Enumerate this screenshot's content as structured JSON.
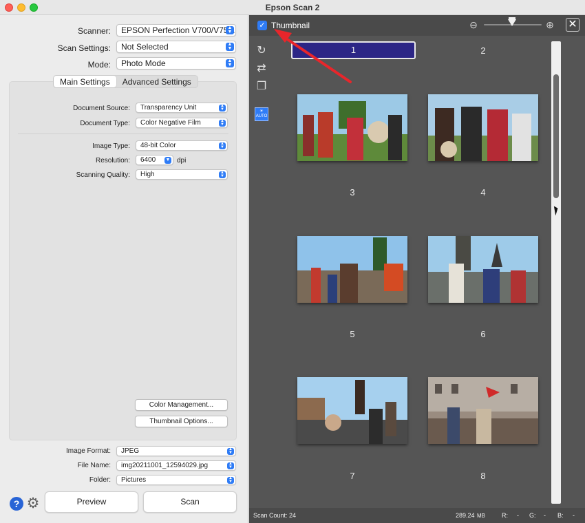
{
  "window": {
    "title": "Epson Scan 2"
  },
  "scanner": {
    "label": "Scanner:",
    "value": "EPSON Perfection V700/V75..."
  },
  "scan_settings": {
    "label": "Scan Settings:",
    "value": "Not Selected"
  },
  "mode": {
    "label": "Mode:",
    "value": "Photo Mode"
  },
  "tabs": {
    "main": "Main Settings",
    "advanced": "Advanced Settings"
  },
  "document_source": {
    "label": "Document Source:",
    "value": "Transparency Unit"
  },
  "document_type": {
    "label": "Document Type:",
    "value": "Color Negative Film"
  },
  "image_type": {
    "label": "Image Type:",
    "value": "48-bit Color"
  },
  "resolution": {
    "label": "Resolution:",
    "value": "6400",
    "unit": "dpi"
  },
  "scanning_quality": {
    "label": "Scanning Quality:",
    "value": "High"
  },
  "buttons": {
    "color_management": "Color Management...",
    "thumbnail_options": "Thumbnail Options...",
    "preview": "Preview",
    "scan": "Scan"
  },
  "image_format": {
    "label": "Image Format:",
    "value": "JPEG"
  },
  "file_name": {
    "label": "File Name:",
    "value": "img20211001_12594029.jpg"
  },
  "folder": {
    "label": "Folder:",
    "value": "Pictures"
  },
  "preview_panel": {
    "thumbnail_checkbox_label": "Thumbnail",
    "thumbnail_checked": true,
    "zoom_level": 0.5,
    "frames": [
      "1",
      "2",
      "3",
      "4",
      "5",
      "6",
      "7",
      "8"
    ],
    "selected_frame": "1"
  },
  "status": {
    "scan_count": "Scan Count: 24",
    "size": "289.24",
    "size_unit": "MB",
    "r_label": "R:",
    "r_value": "-",
    "g_label": "G:",
    "g_value": "-",
    "b_label": "B:",
    "b_value": "-"
  },
  "colors": {
    "accent": "#2f7cf6",
    "selected_frame": "#2c2686",
    "annotation_arrow": "#e8262b"
  }
}
